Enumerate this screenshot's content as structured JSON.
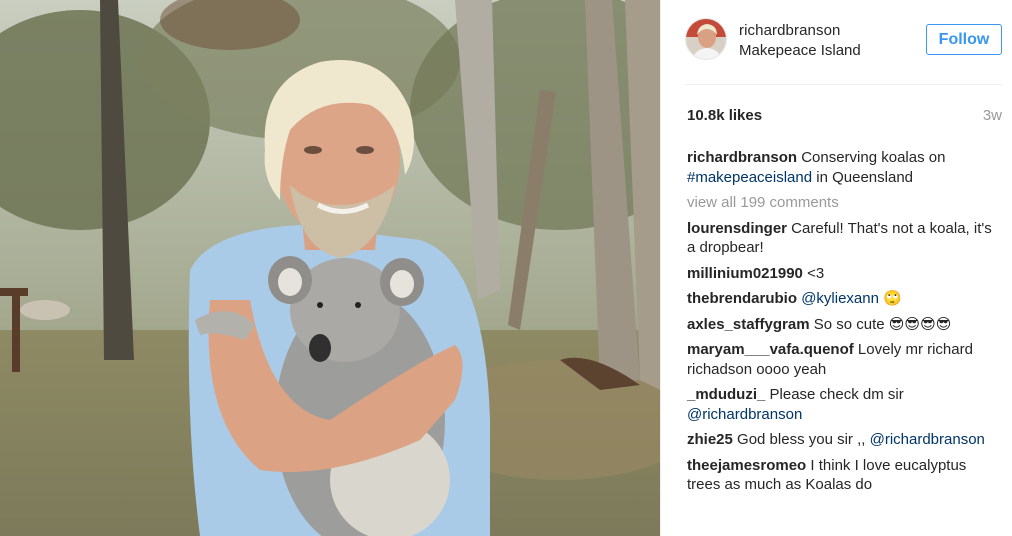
{
  "post": {
    "username": "richardbranson",
    "location": "Makepeace Island",
    "follow_label": "Follow",
    "likes": "10.8k likes",
    "age": "3w",
    "caption": {
      "user": "richardbranson",
      "text_before": " Conserving koalas on ",
      "hashtag": "#makepeaceisland",
      "text_after": " in Queensland"
    },
    "view_all": "view all 199 comments"
  },
  "comments": [
    {
      "user": "lourensdinger",
      "text": " Careful! That's not a koala, it's a dropbear!"
    },
    {
      "user": "millinium021990",
      "text": " <3"
    },
    {
      "user": "thebrendarubio",
      "text": " ",
      "mention": "@kyliexann",
      "after": " 🙄"
    },
    {
      "user": "axles_staffygram",
      "text": " So so cute 😎😎😎😎"
    },
    {
      "user": "maryam___vafa.quenof",
      "text": " Lovely mr richard richadson oooo yeah"
    },
    {
      "user": "_mduduzi_",
      "text": " Please check dm sir ",
      "mention": "@richardbranson"
    },
    {
      "user": "zhie25",
      "text": " God bless you sir ,, ",
      "mention": "@richardbranson"
    },
    {
      "user": "theejamesromeo",
      "text": " I think I love eucalyptus trees as much as Koalas do"
    }
  ],
  "colors": {
    "accent": "#3897f0",
    "text": "#262626",
    "muted": "#999999",
    "link": "#003569"
  },
  "icons": {
    "avatar": "profile-photo"
  }
}
